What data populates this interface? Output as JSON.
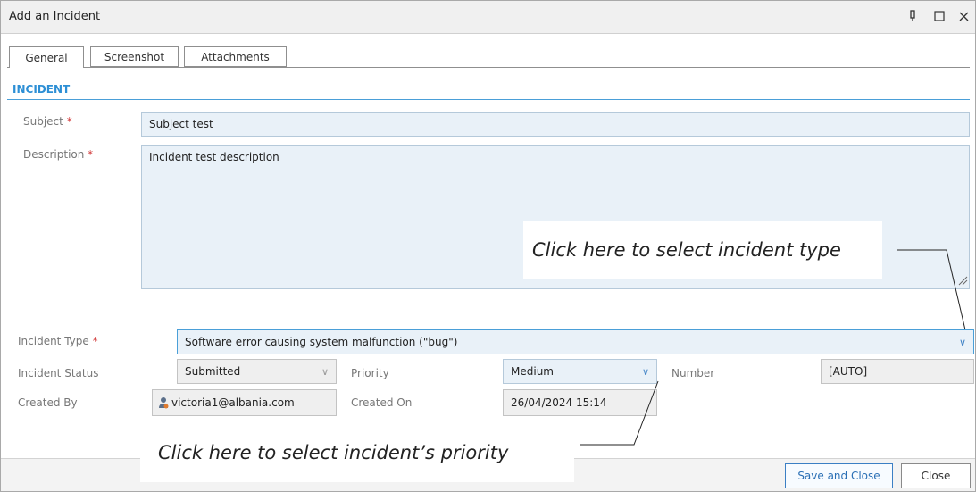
{
  "window": {
    "title": "Add an Incident",
    "pin_icon": "pin-icon",
    "maximize_icon": "maximize-icon",
    "close_icon": "close-icon"
  },
  "tabs": [
    {
      "label": "General",
      "active": true
    },
    {
      "label": "Screenshot",
      "active": false
    },
    {
      "label": "Attachments",
      "active": false
    }
  ],
  "section": {
    "title": "INCIDENT"
  },
  "form": {
    "subject": {
      "label": "Subject",
      "required": "*",
      "value": "Subject test"
    },
    "description": {
      "label": "Description",
      "required": "*",
      "value": "Incident test description"
    },
    "incident_type": {
      "label": "Incident Type",
      "required": "*",
      "value": "Software error causing system malfunction (\"bug\")"
    },
    "incident_status": {
      "label": "Incident Status",
      "value": "Submitted"
    },
    "priority": {
      "label": "Priority",
      "value": "Medium"
    },
    "number": {
      "label": "Number",
      "value": "[AUTO]"
    },
    "created_by": {
      "label": "Created By",
      "value": "victoria1@albania.com",
      "icon": "user-icon"
    },
    "created_on": {
      "label": "Created On",
      "value": "26/04/2024 15:14"
    }
  },
  "annotations": {
    "type_hint": "Click here to select incident type",
    "priority_hint": "Click here to select incident’s priority"
  },
  "footer": {
    "save_close_label": "Save and Close",
    "close_label": "Close"
  },
  "colors": {
    "accent": "#2d8fd5",
    "required": "#d23a3a",
    "field_bg": "#e9f1f8"
  }
}
